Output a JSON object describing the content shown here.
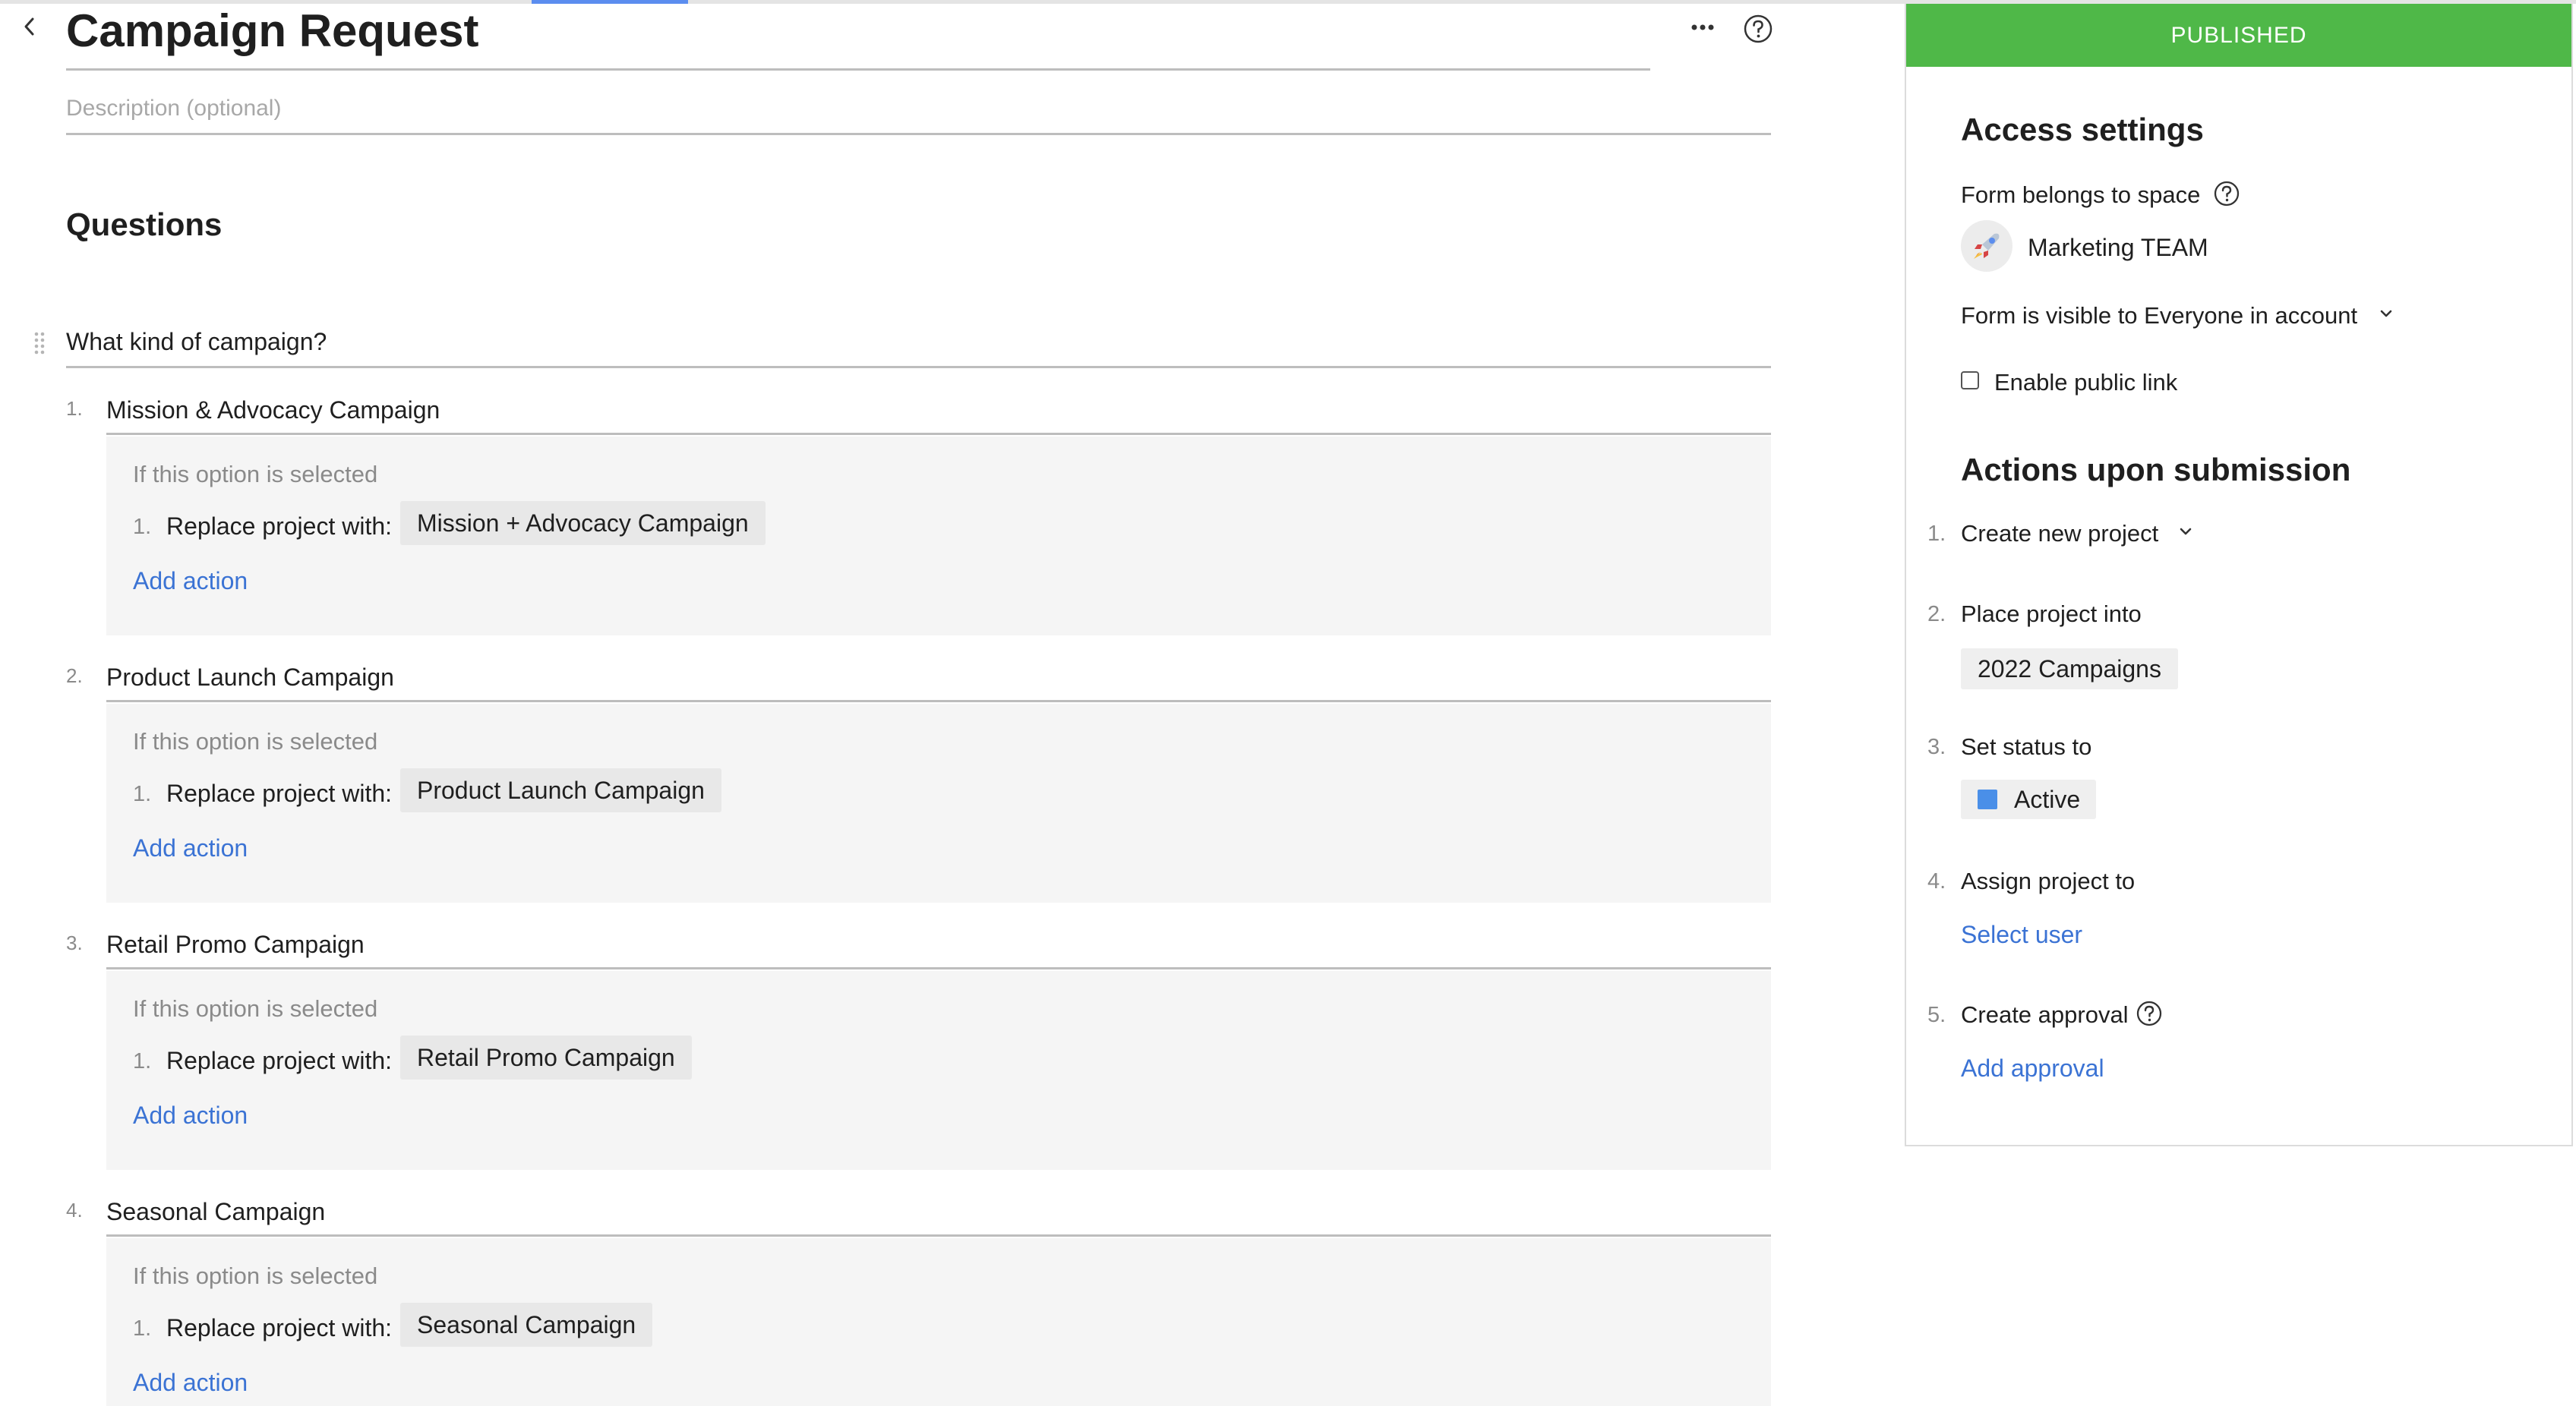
{
  "header": {
    "title": "Campaign Request",
    "description_placeholder": "Description (optional)"
  },
  "section_title": "Questions",
  "question": {
    "text": "What kind of campaign?",
    "options": [
      {
        "number": "1.",
        "label": "Mission & Advocacy Campaign",
        "condition_title": "If this option is selected",
        "action_number": "1.",
        "action_label": "Replace project with:",
        "action_value": "Mission + Advocacy Campaign",
        "add_action": "Add action"
      },
      {
        "number": "2.",
        "label": "Product Launch Campaign",
        "condition_title": "If this option is selected",
        "action_number": "1.",
        "action_label": "Replace project with:",
        "action_value": "Product Launch Campaign",
        "add_action": "Add action"
      },
      {
        "number": "3.",
        "label": "Retail Promo Campaign",
        "condition_title": "If this option is selected",
        "action_number": "1.",
        "action_label": "Replace project with:",
        "action_value": "Retail Promo Campaign",
        "add_action": "Add action"
      },
      {
        "number": "4.",
        "label": "Seasonal Campaign",
        "condition_title": "If this option is selected",
        "action_number": "1.",
        "action_label": "Replace project with:",
        "action_value": "Seasonal Campaign",
        "add_action": "Add action"
      }
    ]
  },
  "sidebar": {
    "status": "PUBLISHED",
    "status_color": "#4fb848",
    "access_title": "Access settings",
    "space_label": "Form belongs to space",
    "space_name": "Marketing TEAM",
    "visibility": "Form is visible to Everyone in account",
    "public_link_label": "Enable public link",
    "public_link_checked": false,
    "actions_title": "Actions upon submission",
    "actions": [
      {
        "number": "1.",
        "label": "Create new project"
      },
      {
        "number": "2.",
        "label": "Place project into",
        "value": "2022 Campaigns"
      },
      {
        "number": "3.",
        "label": "Set status to",
        "value": "Active",
        "value_color": "#4a8fe8"
      },
      {
        "number": "4.",
        "label": "Assign project to",
        "link": "Select user"
      },
      {
        "number": "5.",
        "label": "Create approval",
        "link": "Add approval"
      }
    ]
  },
  "icons": {
    "back": "chevron-left-icon",
    "more": "more-dots-icon",
    "help": "question-circle-icon",
    "drag": "drag-handle-icon",
    "dropdown": "chevron-down-icon",
    "space_avatar": "rocket-icon"
  },
  "accent_color": "#3b73d4"
}
